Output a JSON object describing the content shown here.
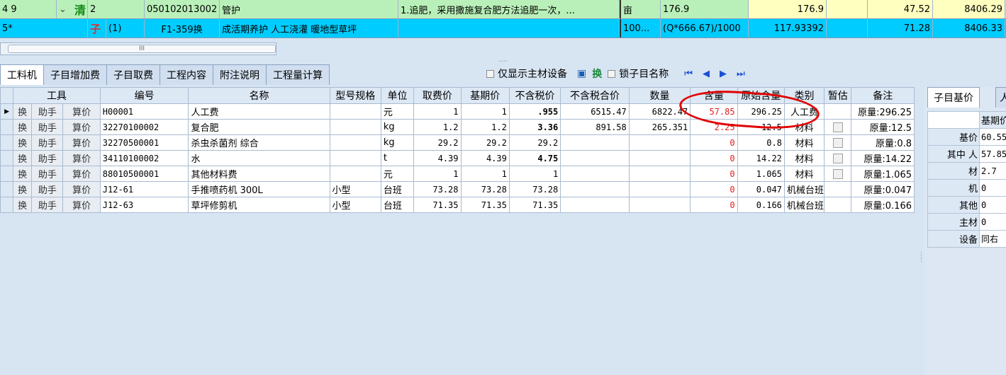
{
  "top_rows": [
    {
      "prefix": "4 9",
      "badge": "清",
      "seq": "2",
      "code": "050102013002",
      "name": "管护",
      "feature": "1.追肥，采用撒施复合肥方法追肥一次，...",
      "unit": "亩",
      "qty_expr": "176.9",
      "qty": "176.9",
      "price": "47.52",
      "total": "8406.29"
    },
    {
      "prefix": "5*",
      "badge": "子",
      "seq": "(1)",
      "code": "F1-359换",
      "name": "成活期养护 人工浇灌 暖地型草坪",
      "feature": "",
      "unit": "100...",
      "qty_expr": "(Q*666.67)/1000",
      "qty": "117.93392",
      "price": "71.28",
      "total": "8406.33"
    }
  ],
  "scroll_grip": "III",
  "divider_dots": "....",
  "tabs": [
    "工料机",
    "子目增加费",
    "子目取费",
    "工程内容",
    "附注说明",
    "工程量计算"
  ],
  "toolbar": {
    "only_main_label": "仅显示主材设备",
    "swap_label": "换",
    "lock_name_label": "锁子目名称"
  },
  "grid": {
    "headers": [
      "工具",
      "编号",
      "名称",
      "型号规格",
      "单位",
      "取费价",
      "基期价",
      "不含税价",
      "不含税合价",
      "数量",
      "含量",
      "原始含量",
      "类别",
      "暂估",
      "备注"
    ],
    "btn_labels": [
      "换",
      "助手",
      "算价"
    ],
    "rows": [
      {
        "code": "H00001",
        "name": "人工费",
        "spec": "",
        "unit": "元",
        "fee": "1",
        "base": "1",
        "notax": ".955",
        "notax_total": "6515.47",
        "qty": "6822.47",
        "content": "57.85",
        "orig": "296.25",
        "type": "人工费",
        "est": false,
        "note": "原量:296.25"
      },
      {
        "code": "32270100002",
        "name": "复合肥",
        "spec": "",
        "unit": "kg",
        "fee": "1.2",
        "base": "1.2",
        "notax": "3.36",
        "notax_total": "891.58",
        "qty": "265.351",
        "content": "2.25",
        "orig": "12.5",
        "type": "材料",
        "est": true,
        "note": "原量:12.5"
      },
      {
        "code": "32270500001",
        "name": "杀虫杀菌剂 综合",
        "spec": "",
        "unit": "kg",
        "fee": "29.2",
        "base": "29.2",
        "notax": "29.2",
        "notax_total": "",
        "qty": "",
        "content": "0",
        "orig": "0.8",
        "type": "材料",
        "est": true,
        "note": "原量:0.8"
      },
      {
        "code": "34110100002",
        "name": "水",
        "spec": "",
        "unit": "t",
        "fee": "4.39",
        "base": "4.39",
        "notax": "4.75",
        "notax_total": "",
        "qty": "",
        "content": "0",
        "orig": "14.22",
        "type": "材料",
        "est": true,
        "note": "原量:14.22"
      },
      {
        "code": "88010500001",
        "name": "其他材料费",
        "spec": "",
        "unit": "元",
        "fee": "1",
        "base": "1",
        "notax": "1",
        "notax_total": "",
        "qty": "",
        "content": "0",
        "orig": "1.065",
        "type": "材料",
        "est": true,
        "note": "原量:1.065"
      },
      {
        "code": "J12-61",
        "name": "手推喷药机 300L",
        "spec": "小型",
        "unit": "台班",
        "fee": "73.28",
        "base": "73.28",
        "notax": "73.28",
        "notax_total": "",
        "qty": "",
        "content": "0",
        "orig": "0.047",
        "type": "机械台班",
        "est": false,
        "note": "原量:0.047"
      },
      {
        "code": "J12-63",
        "name": "草坪修剪机",
        "spec": "小型",
        "unit": "台班",
        "fee": "71.35",
        "base": "71.35",
        "notax": "71.35",
        "notax_total": "",
        "qty": "",
        "content": "0",
        "orig": "0.166",
        "type": "机械台班",
        "est": false,
        "note": "原量:0.166"
      }
    ]
  },
  "right_panel": {
    "tab": "子目基价",
    "tab2": "人",
    "col_header": "基期价",
    "rows": [
      {
        "k": "基价",
        "v": "60.55"
      },
      {
        "k": "其中 人",
        "v": "57.85"
      },
      {
        "k": "材",
        "v": "2.7"
      },
      {
        "k": "机",
        "v": "0"
      },
      {
        "k": "其他",
        "v": "0"
      },
      {
        "k": "主材",
        "v": "0"
      },
      {
        "k": "设备",
        "v": "同右"
      }
    ]
  }
}
